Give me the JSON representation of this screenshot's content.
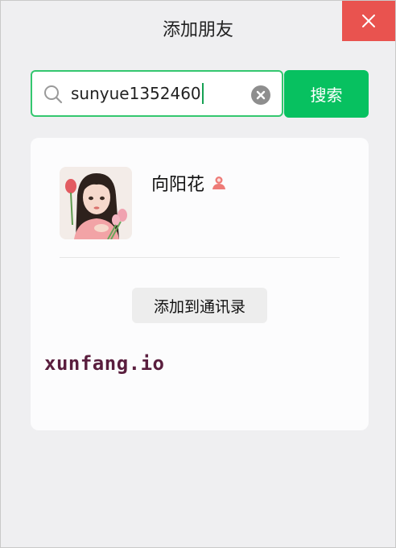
{
  "window": {
    "title": "添加朋友",
    "close_icon": "close-icon"
  },
  "search": {
    "value": "sunyue1352460",
    "search_icon": "search-icon",
    "clear_icon": "clear-icon",
    "button_label": "搜索"
  },
  "result": {
    "name": "向阳花",
    "gender_icon": "female-icon",
    "add_button_label": "添加到通讯录",
    "watermark": "xunfang.io"
  },
  "colors": {
    "accent": "#07c160",
    "close": "#e9534f",
    "watermark": "#5a1e3e"
  }
}
